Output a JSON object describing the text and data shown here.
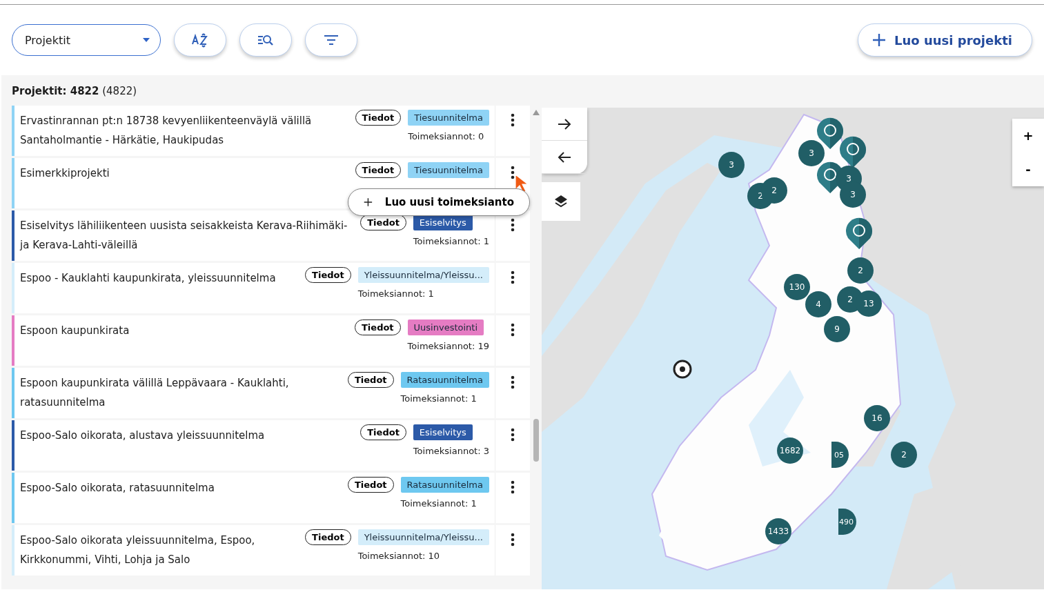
{
  "toolbar": {
    "dropdown": {
      "value": "Projektit"
    },
    "create_button": {
      "label": "Luo uusi projekti"
    }
  },
  "list": {
    "heading": {
      "label": "Projektit:",
      "count": "4822",
      "total": "(4822)"
    },
    "rows": [
      {
        "title": "Ervastinrannan pt:n 18738 kevyenliikenteenväylä välillä Santaholmantie - Härkätie, Haukipudas",
        "color": "#8fd3f5",
        "info": "Tiedot",
        "tag": {
          "label": "Tiesuunnitelma",
          "color": "#8fd3f5"
        },
        "count": "Toimeksiannot: 0"
      },
      {
        "title": "Esimerkkiprojekti",
        "color": "#8fd3f5",
        "info": "Tiedot",
        "tag": {
          "label": "Tiesuunnitelma",
          "color": "#8fd3f5"
        },
        "menu_open": true,
        "menu_item": "Luo uusi toimeksianto"
      },
      {
        "title": "Esiselvitys lähiliikenteen uusista seisakkeista Kerava-Riihimäki- ja Kerava-Lahti-väleillä",
        "color": "#2c5aa8",
        "info": "Tiedot",
        "tag": {
          "label": "Esiselvitys",
          "color": "#2c5aa8"
        },
        "count": "Toimeksiannot: 1"
      },
      {
        "title": "Espoo - Kauklahti kaupunkirata, yleissuunnitelma",
        "color": "#d4edfa",
        "info": "Tiedot",
        "tag": {
          "label": "Yleissuunnitelma/Yleissu...",
          "color": "#d4edfa"
        },
        "count": "Toimeksiannot: 1"
      },
      {
        "title": "Espoon kaupunkirata",
        "color": "#e57cc3",
        "info": "Tiedot",
        "tag": {
          "label": "Uusinvestointi",
          "color": "#e57cc3"
        },
        "count": "Toimeksiannot: 19"
      },
      {
        "title": "Espoon kaupunkirata välillä Leppävaara - Kauklahti, ratasuunnitelma",
        "color": "#6ec8f0",
        "info": "Tiedot",
        "tag": {
          "label": "Ratasuunnitelma",
          "color": "#6ec8f0"
        },
        "count": "Toimeksiannot: 1"
      },
      {
        "title": "Espoo-Salo oikorata, alustava yleissuunnitelma",
        "color": "#2c5aa8",
        "info": "Tiedot",
        "tag": {
          "label": "Esiselvitys",
          "color": "#2c5aa8"
        },
        "count": "Toimeksiannot: 3"
      },
      {
        "title": "Espoo-Salo oikorata, ratasuunnitelma",
        "color": "#6ec8f0",
        "info": "Tiedot",
        "tag": {
          "label": "Ratasuunnitelma",
          "color": "#6ec8f0"
        },
        "count": "Toimeksiannot: 1"
      },
      {
        "title": "Espoo-Salo oikorata yleissuunnitelma, Espoo, Kirkkonummi, Vihti, Lohja ja Salo",
        "color": "#d4edfa",
        "info": "Tiedot",
        "tag": {
          "label": "Yleissuunnitelma/Yleissu...",
          "color": "#d4edfa"
        },
        "count": "Toimeksiannot: 10"
      }
    ]
  },
  "map": {
    "kind": "picture",
    "zoom": {
      "in": "+",
      "out": "-"
    },
    "markers": [
      {
        "kind": "pin"
      },
      {
        "kind": "pin"
      },
      {
        "kind": "pin"
      },
      {
        "kind": "pin"
      },
      {
        "kind": "cluster",
        "label": "3"
      },
      {
        "kind": "cluster",
        "label": "3"
      },
      {
        "kind": "cluster",
        "label": "2"
      },
      {
        "kind": "cluster",
        "label": "2"
      },
      {
        "kind": "cluster",
        "label": "3"
      },
      {
        "kind": "cluster",
        "label": "3"
      },
      {
        "kind": "cluster",
        "label": "2"
      },
      {
        "kind": "cluster",
        "label": "130"
      },
      {
        "kind": "cluster",
        "label": "4"
      },
      {
        "kind": "cluster",
        "label": "2"
      },
      {
        "kind": "cluster",
        "label": "13"
      },
      {
        "kind": "cluster",
        "label": "9"
      },
      {
        "kind": "cluster",
        "label": "16"
      },
      {
        "kind": "cluster",
        "label": "1682"
      },
      {
        "kind": "half",
        "label": "05"
      },
      {
        "kind": "cluster",
        "label": "2"
      },
      {
        "kind": "cluster",
        "label": "1433"
      },
      {
        "kind": "half",
        "label": "490"
      }
    ]
  }
}
